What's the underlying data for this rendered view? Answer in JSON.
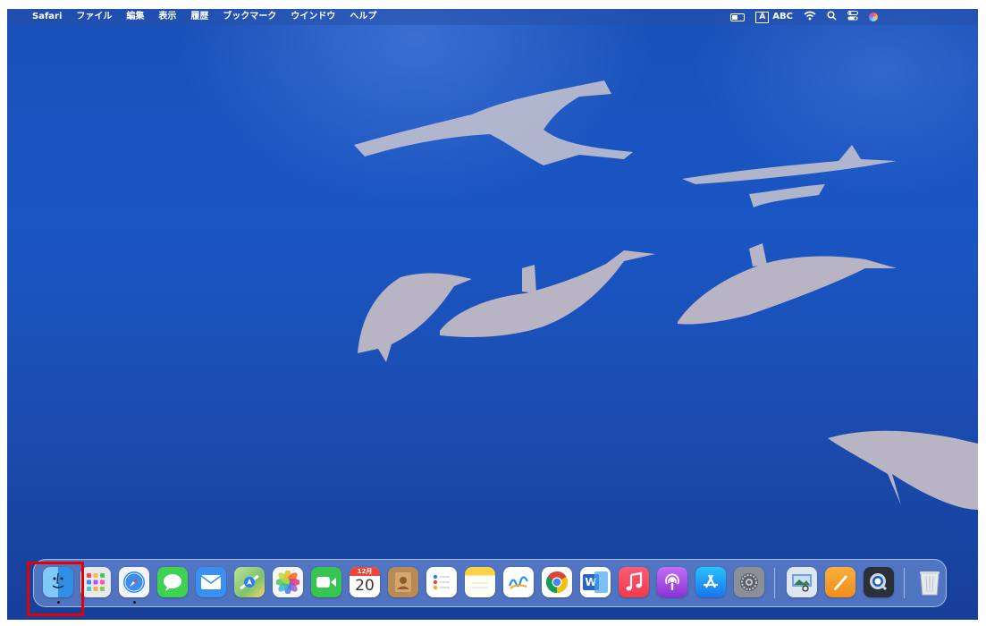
{
  "menubar": {
    "app_name": "Safari",
    "menus": [
      "ファイル",
      "編集",
      "表示",
      "履歴",
      "ブックマーク",
      "ウインドウ",
      "ヘルプ"
    ],
    "input_indicator": "A",
    "input_source": "ABC",
    "status_icons": [
      "battery-icon",
      "wifi-icon",
      "spotlight-search-icon",
      "control-center-icon",
      "siri-icon"
    ]
  },
  "dock": {
    "apps": [
      {
        "name": "Finder",
        "icon": "finder-icon",
        "running": true,
        "color": "#4aa8f0"
      },
      {
        "name": "Launchpad",
        "icon": "launchpad-icon",
        "running": false,
        "color": "#e8e8ef"
      },
      {
        "name": "Safari",
        "icon": "safari-icon",
        "running": true,
        "color": "#3b8ef0"
      },
      {
        "name": "Messages",
        "icon": "messages-icon",
        "running": false,
        "color": "#3fd152"
      },
      {
        "name": "Mail",
        "icon": "mail-icon",
        "running": false,
        "color": "#3a8ff5"
      },
      {
        "name": "Maps",
        "icon": "maps-icon",
        "running": false,
        "color": "#7ec36b"
      },
      {
        "name": "Photos",
        "icon": "photos-icon",
        "running": false,
        "color": "#f5f5f5"
      },
      {
        "name": "FaceTime",
        "icon": "facetime-icon",
        "running": false,
        "color": "#37c552"
      },
      {
        "name": "Calendar",
        "icon": "calendar-icon",
        "running": false,
        "color": "#ffffff",
        "month": "12月",
        "day": "20"
      },
      {
        "name": "Contacts",
        "icon": "contacts-icon",
        "running": false,
        "color": "#b98a55"
      },
      {
        "name": "Reminders",
        "icon": "reminders-icon",
        "running": false,
        "color": "#ffffff"
      },
      {
        "name": "Notes",
        "icon": "notes-icon",
        "running": false,
        "color": "#ffe27a"
      },
      {
        "name": "Freeform",
        "icon": "freeform-icon",
        "running": false,
        "color": "#ffffff"
      },
      {
        "name": "Google Chrome",
        "icon": "chrome-icon",
        "running": false,
        "color": "#ffffff"
      },
      {
        "name": "Microsoft Word",
        "icon": "word-icon",
        "running": false,
        "color": "#2b64c8",
        "label": "W"
      },
      {
        "name": "Music",
        "icon": "music-icon",
        "running": false,
        "color": "#f23a4e"
      },
      {
        "name": "Podcasts",
        "icon": "podcasts-icon",
        "running": false,
        "color": "#9d45e0"
      },
      {
        "name": "App Store",
        "icon": "app-store-icon",
        "running": false,
        "color": "#2e8cf2"
      },
      {
        "name": "System Settings",
        "icon": "system-settings-icon",
        "running": false,
        "color": "#8a8f98"
      },
      {
        "name": "Preview",
        "icon": "preview-icon",
        "running": false,
        "color": "#dfe6f0"
      },
      {
        "name": "Pages",
        "icon": "pages-icon",
        "running": false,
        "color": "#f39a2a"
      },
      {
        "name": "QuickTime Player",
        "icon": "quicktime-icon",
        "running": false,
        "color": "#2a2f3a"
      },
      {
        "name": "Trash",
        "icon": "trash-icon",
        "running": false,
        "color": "#dfe3e8"
      }
    ]
  },
  "highlight": {
    "target": "Finder",
    "color": "#e60000"
  }
}
